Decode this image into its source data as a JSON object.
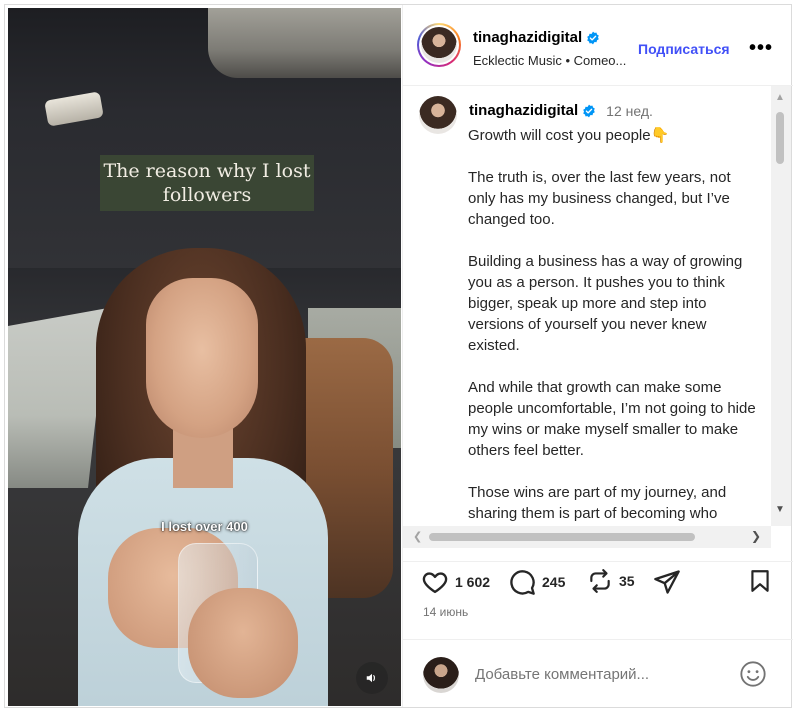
{
  "video": {
    "overlay_title": "The reason why I lost followers",
    "caption": "I lost over 400",
    "sound_icon": "speaker-icon"
  },
  "header": {
    "username": "tinaghazidigital",
    "subtitle": "Ecklectic Music • Comeo...",
    "follow_label": "Подписаться",
    "more_label": "•••"
  },
  "post": {
    "username": "tinaghazidigital",
    "time": "12 нед.",
    "paragraphs": [
      "Growth will cost you people👇",
      "The truth is, over the last few years, not only has my business changed, but I’ve changed too.",
      "Building a business has a way of growing you as a person. It pushes you to think bigger, speak up more and step into versions of yourself you never knew existed.",
      "And while that growth can make some people uncomfortable, I’m not going to hide my wins or make myself smaller to make others feel better.",
      "Those wins are part of my journey, and sharing them is part of becoming who"
    ]
  },
  "actions": {
    "likes": "1 602",
    "comments": "245",
    "reposts": "35"
  },
  "date": "14 июнь",
  "comment_box": {
    "placeholder": "Добавьте комментарий..."
  },
  "colors": {
    "follow": "#4150f7",
    "verified": "#0095f6",
    "title_box": "#3a4634"
  }
}
